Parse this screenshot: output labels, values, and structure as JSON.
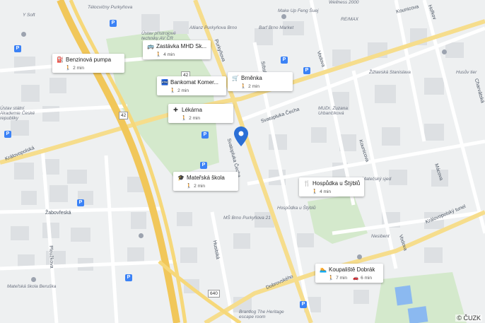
{
  "map": {
    "copyright": "© ČUZK",
    "street_labels": [
      "Královopolská",
      "Kounicova",
      "Purkyňova",
      "Svatopluka Čecha",
      "Vodova",
      "Srbská",
      "Svatopluka Čecha",
      "Žabovřeská",
      "Ploužkova",
      "Husitská",
      "Dobrovského",
      "Královopolský tunel",
      "Vodova",
      "Mácova",
      "Kounicova"
    ],
    "place_labels": [
      "Télocvičny Purkyňova",
      "Y Soft",
      "Ústav přístrojové techniky AV ČR",
      "Allianz Purkyňova Brno",
      "Barf Brno Market",
      "Make Up Feng Šuej",
      "Wellness 2000",
      "RE/MAX",
      "Žižlavská Stanislava",
      "Husův tier",
      "MUDr. Zuzana Urbančíková",
      "Matečský sjed",
      "Hospůdka u Štýblů",
      "Nesibent",
      "MŠ Brno Purkyňova 21",
      "Mateřská škola Beruška",
      "Brantlog The Heritage escape room",
      "Ústav státní Akademie České republiky",
      "Charvátská",
      "Hofkov"
    ],
    "road_numbers": [
      "42",
      "42",
      "640"
    ]
  },
  "places": [
    {
      "name": "Benzinová pumpa",
      "icon": "gas-station-icon",
      "mode_icon": "walk-icon",
      "time": "2 min"
    },
    {
      "name": "Zastávka MHD Sk...",
      "icon": "bus-icon",
      "mode_icon": "walk-icon",
      "time": "4 min"
    },
    {
      "name": "Bankomat Komer...",
      "icon": "atm-icon",
      "mode_icon": "walk-icon",
      "time": "2 min"
    },
    {
      "name": "Brněnka",
      "icon": "shop-icon",
      "mode_icon": "walk-icon",
      "time": "2 min"
    },
    {
      "name": "Lékárna",
      "icon": "pharmacy-icon",
      "mode_icon": "walk-icon",
      "time": "2 min"
    },
    {
      "name": "Mateřská škola",
      "icon": "school-icon",
      "mode_icon": "walk-icon",
      "time": "2 min"
    },
    {
      "name": "Hospůdka u Štýblů",
      "icon": "restaurant-icon",
      "mode_icon": "walk-icon",
      "time": "4 min"
    },
    {
      "name": "Koupaliště Dobrák",
      "icon": "swimming-icon",
      "mode_icon": "walk-icon",
      "time": "7 min",
      "mode2_icon": "car-icon",
      "time2": "6 min"
    }
  ],
  "pin": {
    "icon": "location-pin-icon",
    "color": "#2b6fd6"
  },
  "colors": {
    "background": "#eef0f1",
    "major_road": "#f6d36e",
    "road": "#ffffff",
    "park": "#cfe7c6",
    "water": "#8bb9f0",
    "building": "#dcdfe2"
  }
}
